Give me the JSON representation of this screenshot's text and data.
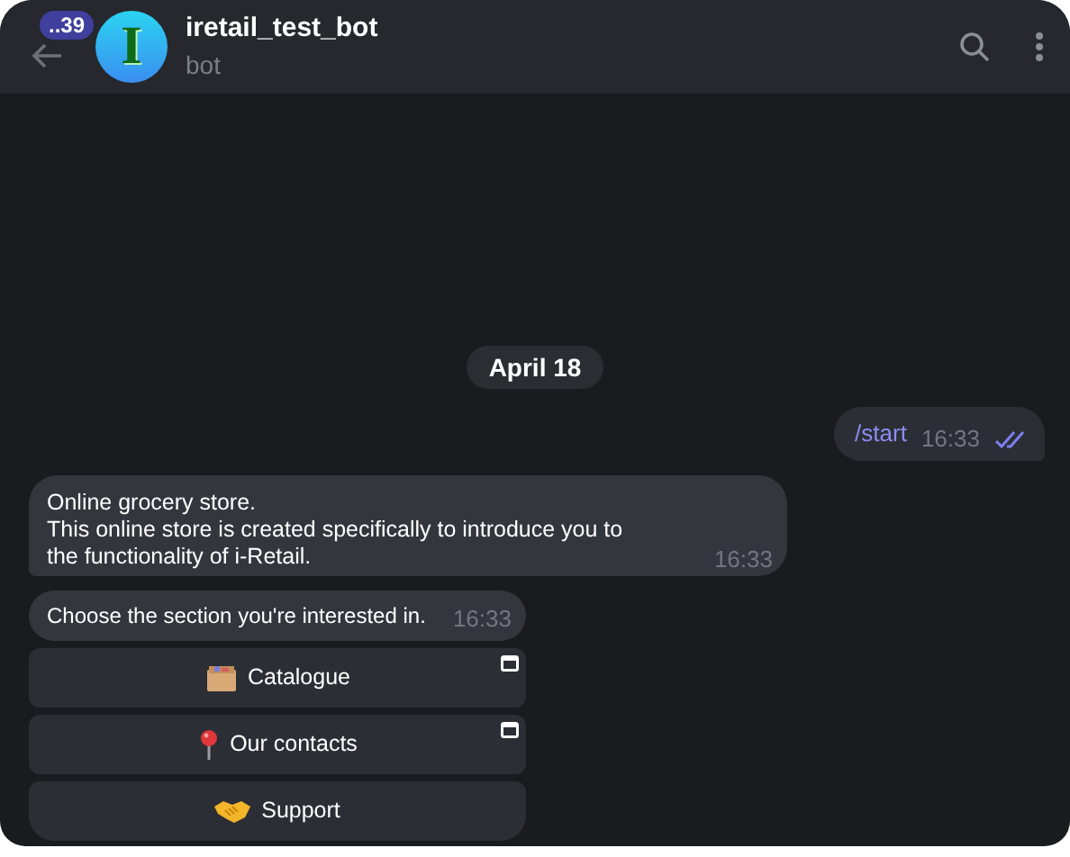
{
  "header": {
    "badge": "..39",
    "avatar_letter": "I",
    "title": "iretail_test_bot",
    "subtitle": "bot"
  },
  "date": "April 18",
  "messages": [
    {
      "kind": "outgoing",
      "text": "/start",
      "time": "16:33",
      "read": true
    },
    {
      "kind": "incoming",
      "lines": [
        "Online grocery store.",
        "This online store is created specifically to introduce you to",
        "the functionality of i-Retail."
      ],
      "time": "16:33"
    },
    {
      "kind": "incoming",
      "lines": [
        "Choose the section you're interested in."
      ],
      "time": "16:33"
    }
  ],
  "keyboard": [
    {
      "kind": "catalogue",
      "label": "Catalogue",
      "web_app": true
    },
    {
      "kind": "contacts",
      "label": "Our contacts",
      "web_app": true
    },
    {
      "kind": "support",
      "label": "Support",
      "web_app": false
    }
  ]
}
